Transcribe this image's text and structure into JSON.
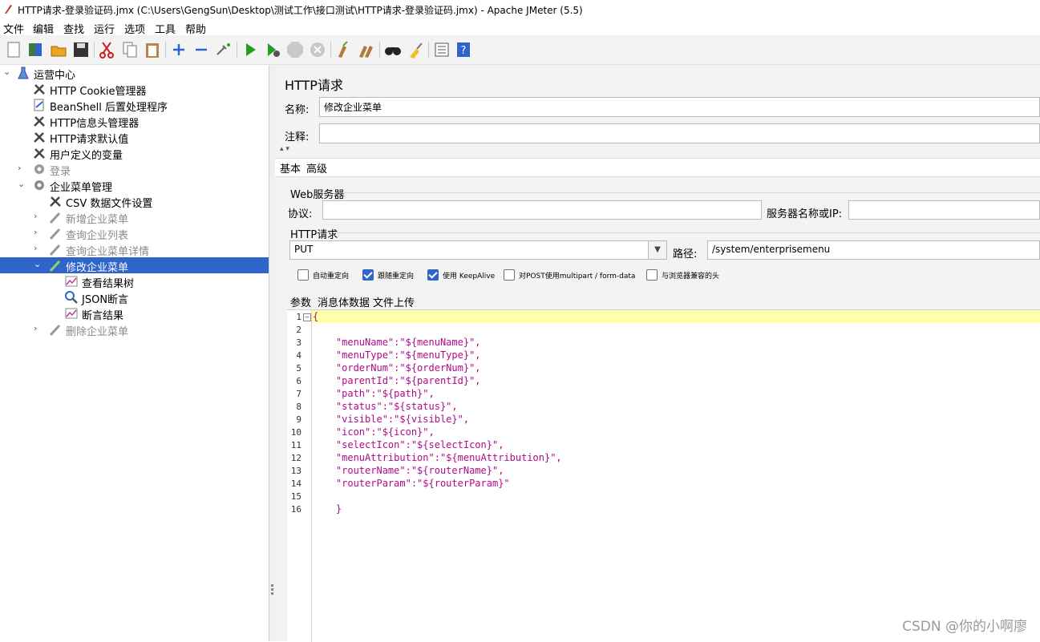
{
  "window": {
    "title": "HTTP请求-登录验证码.jmx (C:\\Users\\GengSun\\Desktop\\测试工作\\接口测试\\HTTP请求-登录验证码.jmx) - Apache JMeter (5.5)"
  },
  "menu": [
    "文件",
    "编辑",
    "查找",
    "运行",
    "选项",
    "工具",
    "帮助"
  ],
  "toolbar": [
    "new-icon",
    "templates-icon",
    "open-icon",
    "save-icon",
    "cut-icon",
    "copy-icon",
    "paste-icon",
    "add-icon",
    "remove-icon",
    "toggle-icon",
    "start-icon",
    "start-no-pause-icon",
    "stop-icon",
    "shutdown-icon",
    "clear-icon",
    "clear-all-icon",
    "search-icon",
    "reset-search-icon",
    "function-helper-icon",
    "help-icon"
  ],
  "tree": [
    {
      "label": "运营中心",
      "level": 0,
      "icon": "testplan-icon",
      "arrow": "down",
      "disabled": false
    },
    {
      "label": "HTTP Cookie管理器",
      "level": 1,
      "icon": "config-icon",
      "arrow": "",
      "disabled": false
    },
    {
      "label": "BeanShell 后置处理程序",
      "level": 1,
      "icon": "postprocessor-icon",
      "arrow": "",
      "disabled": false
    },
    {
      "label": "HTTP信息头管理器",
      "level": 1,
      "icon": "config-icon",
      "arrow": "",
      "disabled": false
    },
    {
      "label": "HTTP请求默认值",
      "level": 1,
      "icon": "config-icon",
      "arrow": "",
      "disabled": false
    },
    {
      "label": "用户定义的变量",
      "level": 1,
      "icon": "config-icon",
      "arrow": "",
      "disabled": false
    },
    {
      "label": "登录",
      "level": 1,
      "icon": "threadgroup-icon",
      "arrow": "right",
      "disabled": true
    },
    {
      "label": "企业菜单管理",
      "level": 1,
      "icon": "threadgroup-icon",
      "arrow": "down",
      "disabled": false
    },
    {
      "label": "CSV 数据文件设置",
      "level": 2,
      "icon": "config-icon",
      "arrow": "",
      "disabled": false
    },
    {
      "label": "新增企业菜单",
      "level": 2,
      "icon": "sampler-icon",
      "arrow": "right",
      "disabled": true
    },
    {
      "label": "查询企业列表",
      "level": 2,
      "icon": "sampler-icon",
      "arrow": "right",
      "disabled": true
    },
    {
      "label": "查询企业菜单详情",
      "level": 2,
      "icon": "sampler-icon",
      "arrow": "right",
      "disabled": true
    },
    {
      "label": "修改企业菜单",
      "level": 2,
      "icon": "sampler-icon",
      "arrow": "down",
      "disabled": false,
      "selected": true
    },
    {
      "label": "查看结果树",
      "level": 3,
      "icon": "listener-icon",
      "arrow": "",
      "disabled": false
    },
    {
      "label": "JSON断言",
      "level": 3,
      "icon": "assertion-icon",
      "arrow": "",
      "disabled": false
    },
    {
      "label": "断言结果",
      "level": 3,
      "icon": "listener-icon",
      "arrow": "",
      "disabled": false
    },
    {
      "label": "删除企业菜单",
      "level": 2,
      "icon": "sampler-icon",
      "arrow": "right",
      "disabled": true
    }
  ],
  "panel": {
    "title": "HTTP请求",
    "name_label": "名称:",
    "name_value": "修改企业菜单",
    "comment_label": "注释:",
    "comment_value": "",
    "tabs": [
      "基本",
      "高级"
    ],
    "web_server_title": "Web服务器",
    "protocol_label": "协议:",
    "protocol_value": "",
    "server_label": "服务器名称或IP:",
    "server_value": "",
    "http_request_title": "HTTP请求",
    "method": "PUT",
    "path_label": "路径:",
    "path_value": "/system/enterprisemenu",
    "checkboxes": [
      {
        "label": "自动重定向",
        "checked": false
      },
      {
        "label": "跟随重定向",
        "checked": true
      },
      {
        "label": "使用 KeepAlive",
        "checked": true
      },
      {
        "label": "对POST使用multipart / form-data",
        "checked": false
      },
      {
        "label": "与浏览器兼容的头",
        "checked": false
      }
    ],
    "body_tabs": [
      "参数",
      "消息体数据",
      "文件上传"
    ],
    "body_lines": [
      "{",
      "",
      "    \"menuName\":\"${menuName}\",",
      "    \"menuType\":\"${menuType}\",",
      "    \"orderNum\":\"${orderNum}\",",
      "    \"parentId\":\"${parentId}\",",
      "    \"path\":\"${path}\",",
      "    \"status\":\"${status}\",",
      "    \"visible\":\"${visible}\",",
      "    \"icon\":\"${icon}\",",
      "    \"selectIcon\":\"${selectIcon}\",",
      "    \"menuAttribution\":\"${menuAttribution}\",",
      "    \"routerName\":\"${routerName}\",",
      "    \"routerParam\":\"${routerParam}\"",
      "",
      "    }"
    ]
  },
  "watermark": "CSDN @你的小啊廖"
}
